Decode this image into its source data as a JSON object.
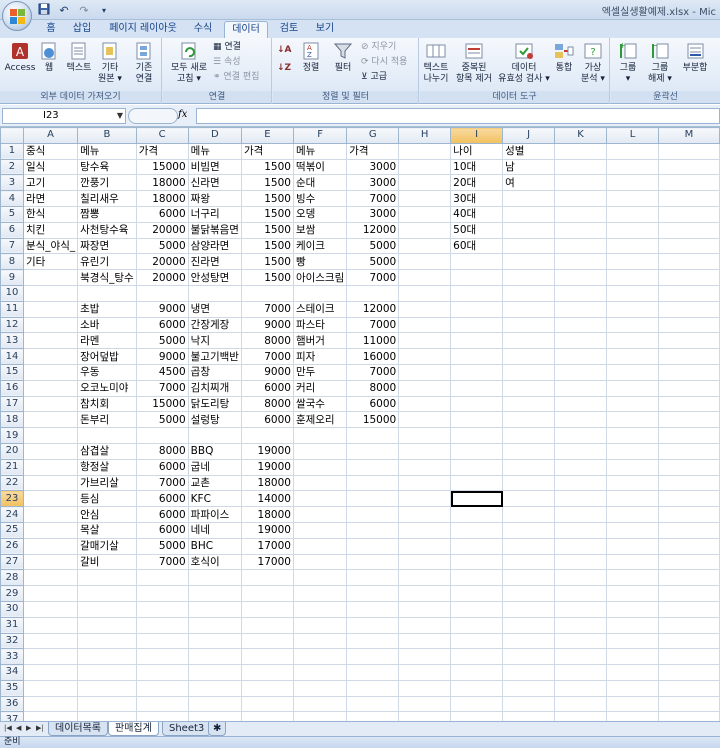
{
  "window": {
    "title": "엑셀실생활예제.xlsx - Mic"
  },
  "qat": {
    "save_icon": "save-icon",
    "undo_icon": "undo-icon",
    "redo_icon": "redo-icon"
  },
  "ribbon_tabs": [
    "홈",
    "삽입",
    "페이지 레이아웃",
    "수식",
    "데이터",
    "검토",
    "보기"
  ],
  "ribbon": {
    "external": {
      "access": "Access",
      "web": "웹",
      "text": "텍스트",
      "other_1": "기타",
      "other_2": "원본 ▾",
      "existing_1": "기존",
      "existing_2": "연결",
      "label": "외부 데이터 가져오기"
    },
    "connections": {
      "refresh_1": "모두 새로",
      "refresh_2": "고침 ▾",
      "connect": "연결",
      "props": "속성",
      "edit": "연결 편집",
      "label": "연결"
    },
    "sortfilter": {
      "sort": "정렬",
      "filter": "필터",
      "clear": "지우기",
      "reapply": "다시 적용",
      "advanced": "고급",
      "label": "정렬 및 필터"
    },
    "datatools": {
      "t2c_1": "텍스트",
      "t2c_2": "나누기",
      "dup_1": "중복된",
      "dup_2": "항목 제거",
      "valid_1": "데이터",
      "valid_2": "유효성 검사 ▾",
      "consol": "통합",
      "whatif_1": "가상",
      "whatif_2": "분석 ▾",
      "label": "데이터 도구"
    },
    "outline": {
      "group_1": "그룹",
      "group_2": "▾",
      "ungroup_1": "그룹",
      "ungroup_2": "해제 ▾",
      "subtotal": "부분합",
      "label": "윤곽선"
    }
  },
  "formula_bar": {
    "name_box": "I23",
    "fx": "fx",
    "formula": ""
  },
  "columns": [
    "A",
    "B",
    "C",
    "D",
    "E",
    "F",
    "G",
    "H",
    "I",
    "J",
    "K",
    "L",
    "M"
  ],
  "selected": {
    "row": 23,
    "col": "I"
  },
  "rows": [
    [
      "중식",
      "메뉴",
      "가격",
      "메뉴",
      "가격",
      "메뉴",
      "가격",
      "",
      "나이",
      "성별",
      "",
      "",
      ""
    ],
    [
      "일식",
      "탕수육",
      "15000",
      "비빔면",
      "1500",
      "떡볶이",
      "3000",
      "",
      "10대",
      "남",
      "",
      "",
      ""
    ],
    [
      "고기",
      "깐풍기",
      "18000",
      "신라면",
      "1500",
      "순대",
      "3000",
      "",
      "20대",
      "여",
      "",
      "",
      ""
    ],
    [
      "라면",
      "칠리새우",
      "18000",
      "짜왕",
      "1500",
      "빙수",
      "7000",
      "",
      "30대",
      "",
      "",
      "",
      ""
    ],
    [
      "한식",
      "짬뽕",
      "6000",
      "너구리",
      "1500",
      "오뎅",
      "3000",
      "",
      "40대",
      "",
      "",
      "",
      ""
    ],
    [
      "치킨",
      "사천탕수육",
      "20000",
      "불닭볶음면",
      "1500",
      "보쌈",
      "12000",
      "",
      "50대",
      "",
      "",
      "",
      ""
    ],
    [
      "분식_야식_",
      "짜장면",
      "5000",
      "삼양라면",
      "1500",
      "케이크",
      "5000",
      "",
      "60대",
      "",
      "",
      "",
      ""
    ],
    [
      "기타",
      "유린기",
      "20000",
      "진라면",
      "1500",
      "빵",
      "5000",
      "",
      "",
      "",
      "",
      "",
      ""
    ],
    [
      "",
      "북경식_탕수",
      "20000",
      "안성탕면",
      "1500",
      "아이스크림",
      "7000",
      "",
      "",
      "",
      "",
      "",
      ""
    ],
    [
      "",
      "",
      "",
      "",
      "",
      "",
      "",
      "",
      "",
      "",
      "",
      "",
      ""
    ],
    [
      "",
      "초밥",
      "9000",
      "냉면",
      "7000",
      "스테이크",
      "12000",
      "",
      "",
      "",
      "",
      "",
      ""
    ],
    [
      "",
      "소바",
      "6000",
      "간장게장",
      "9000",
      "파스타",
      "7000",
      "",
      "",
      "",
      "",
      "",
      ""
    ],
    [
      "",
      "라멘",
      "5000",
      "낙지",
      "8000",
      "햄버거",
      "11000",
      "",
      "",
      "",
      "",
      "",
      ""
    ],
    [
      "",
      "장어덮밥",
      "9000",
      "불고기백반",
      "7000",
      "피자",
      "16000",
      "",
      "",
      "",
      "",
      "",
      ""
    ],
    [
      "",
      "우동",
      "4500",
      "곱창",
      "9000",
      "만두",
      "7000",
      "",
      "",
      "",
      "",
      "",
      ""
    ],
    [
      "",
      "오코노미야",
      "7000",
      "김치찌개",
      "6000",
      "커리",
      "8000",
      "",
      "",
      "",
      "",
      "",
      ""
    ],
    [
      "",
      "참치회",
      "15000",
      "닭도리탕",
      "8000",
      "쌀국수",
      "6000",
      "",
      "",
      "",
      "",
      "",
      ""
    ],
    [
      "",
      "돈부리",
      "5000",
      "설렁탕",
      "6000",
      "훈제오리",
      "15000",
      "",
      "",
      "",
      "",
      "",
      ""
    ],
    [
      "",
      "",
      "",
      "",
      "",
      "",
      "",
      "",
      "",
      "",
      "",
      "",
      ""
    ],
    [
      "",
      "삼겹살",
      "8000",
      "BBQ",
      "19000",
      "",
      "",
      "",
      "",
      "",
      "",
      "",
      ""
    ],
    [
      "",
      "항정살",
      "6000",
      "굽네",
      "19000",
      "",
      "",
      "",
      "",
      "",
      "",
      "",
      ""
    ],
    [
      "",
      "가브리살",
      "7000",
      "교촌",
      "18000",
      "",
      "",
      "",
      "",
      "",
      "",
      "",
      ""
    ],
    [
      "",
      "등심",
      "6000",
      "KFC",
      "14000",
      "",
      "",
      "",
      "",
      "",
      "",
      "",
      ""
    ],
    [
      "",
      "안심",
      "6000",
      "파파이스",
      "18000",
      "",
      "",
      "",
      "",
      "",
      "",
      "",
      ""
    ],
    [
      "",
      "목살",
      "6000",
      "네네",
      "19000",
      "",
      "",
      "",
      "",
      "",
      "",
      "",
      ""
    ],
    [
      "",
      "갈매기살",
      "5000",
      "BHC",
      "17000",
      "",
      "",
      "",
      "",
      "",
      "",
      "",
      ""
    ],
    [
      "",
      "갈비",
      "7000",
      "호식이",
      "17000",
      "",
      "",
      "",
      "",
      "",
      "",
      "",
      ""
    ]
  ],
  "total_rows": 37,
  "numeric_columns": [
    "C",
    "E",
    "G"
  ],
  "sheet_tabs": [
    "데이터목록",
    "판매집계",
    "Sheet3"
  ],
  "active_sheet": "판매집계",
  "status": "준비"
}
